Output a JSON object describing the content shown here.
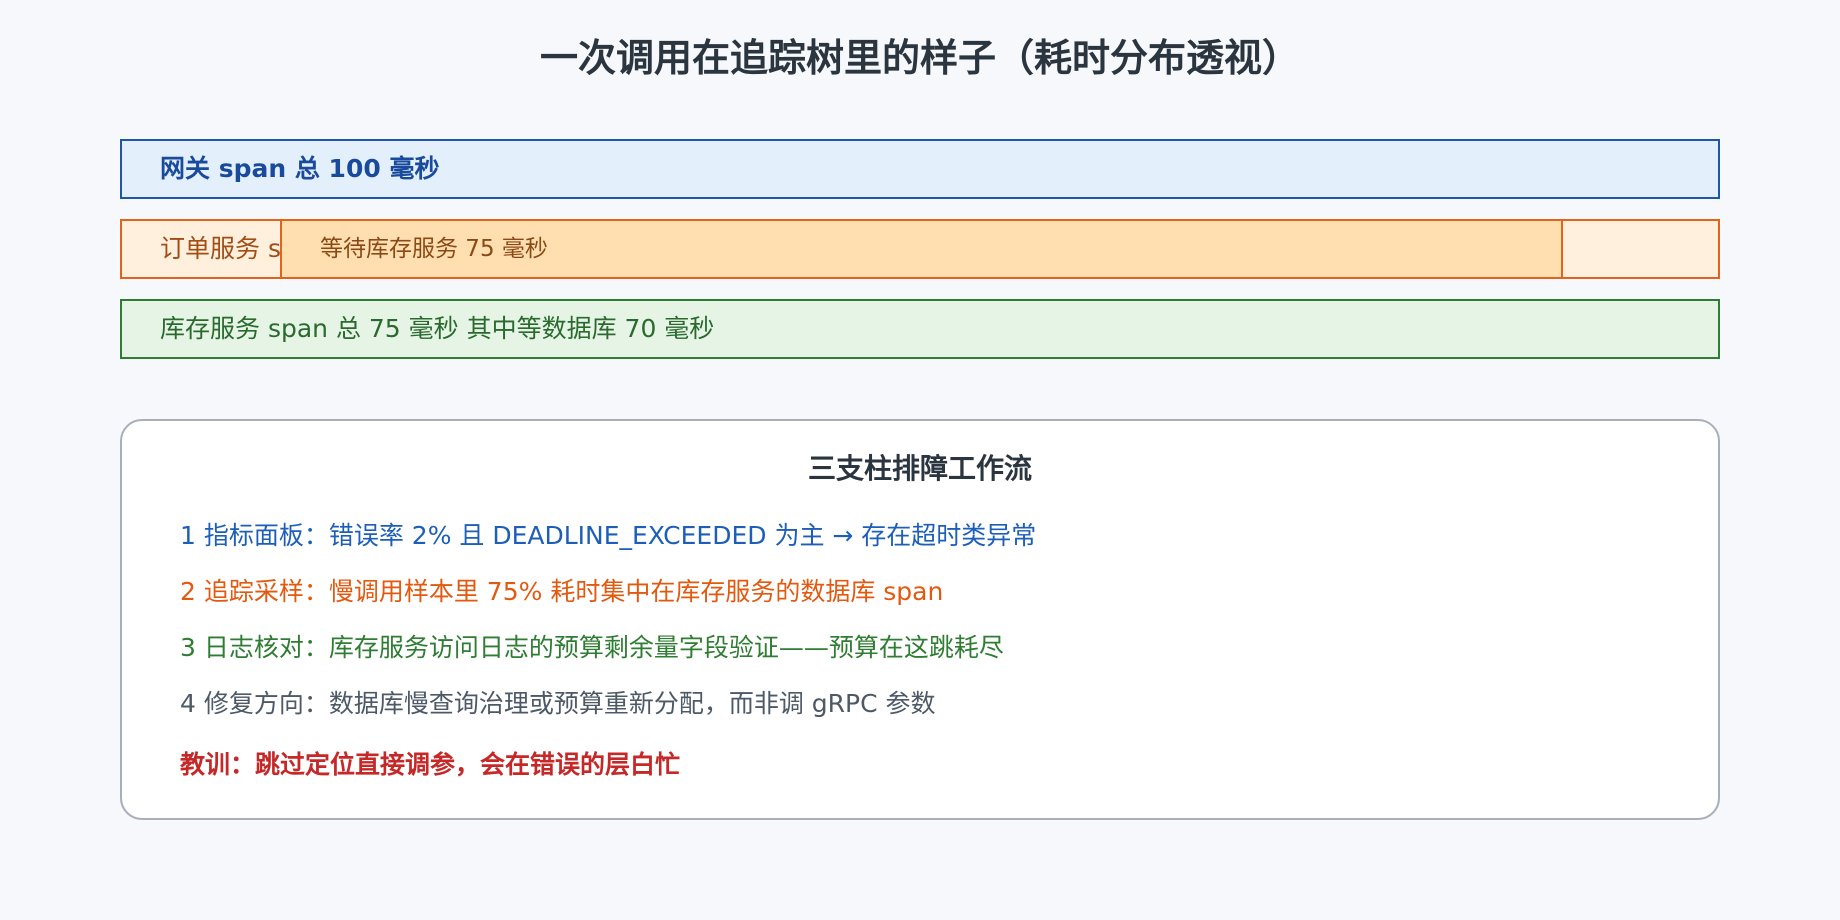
{
  "title": "一次调用在追踪树里的样子（耗时分布透视）",
  "spans": {
    "gateway": {
      "label": "网关 span 总 100 毫秒",
      "duration_ms": 100
    },
    "order": {
      "label": "订单服务 s",
      "duration_ms": 100
    },
    "order_wait": {
      "label": "等待库存服务 75 毫秒",
      "duration_ms": 75
    },
    "inventory": {
      "label": "库存服务 span 总 75 毫秒 其中等数据库 70 毫秒",
      "duration_ms": 75,
      "db_wait_ms": 70
    }
  },
  "workflow": {
    "title": "三支柱排障工作流",
    "steps": [
      {
        "text": "1 指标面板：错误率 2% 且 DEADLINE_EXCEEDED 为主 → 存在超时类异常",
        "color": "#1d5fb8"
      },
      {
        "text": "2 追踪采样：慢调用样本里 75% 耗时集中在库存服务的数据库 span",
        "color": "#e2590f"
      },
      {
        "text": "3 日志核对：库存服务访问日志的预算剩余量字段验证——预算在这跳耗尽",
        "color": "#2e7d32"
      },
      {
        "text": "4 修复方向：数据库慢查询治理或预算重新分配，而非调 gRPC 参数",
        "color": "#4d5966"
      }
    ],
    "lesson": "教训：跳过定位直接调参，会在错误的层白忙"
  },
  "colors": {
    "gateway": "#1e57a8",
    "order": "#e2631d",
    "inventory": "#2e7d32",
    "lesson": "#c62828"
  }
}
